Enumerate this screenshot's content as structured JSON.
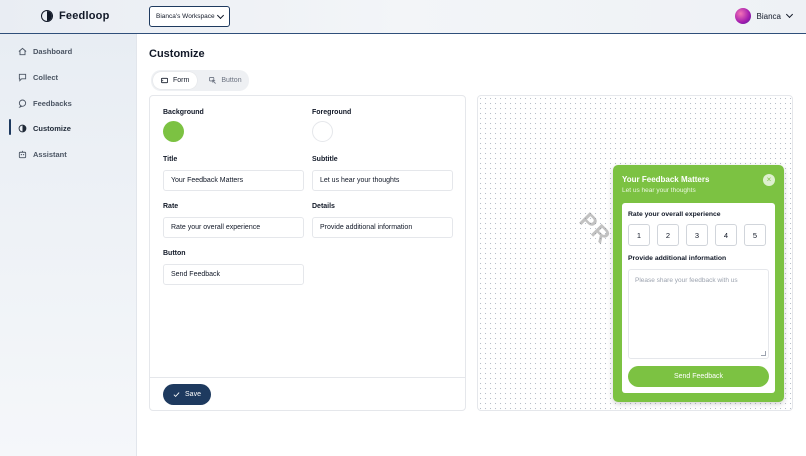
{
  "app": {
    "name": "Feedloop"
  },
  "header": {
    "workspace_label": "Bianca's Workspace",
    "user_name": "Bianca"
  },
  "sidebar": {
    "items": [
      {
        "label": "Dashboard",
        "icon": "home-icon"
      },
      {
        "label": "Collect",
        "icon": "chat-collect-icon"
      },
      {
        "label": "Feedbacks",
        "icon": "chat-bubble-icon"
      },
      {
        "label": "Customize",
        "icon": "half-circle-icon",
        "active": true
      },
      {
        "label": "Assistant",
        "icon": "robot-icon"
      }
    ]
  },
  "page": {
    "title": "Customize"
  },
  "tabs": [
    {
      "label": "Form",
      "icon": "form-icon",
      "active": true
    },
    {
      "label": "Button",
      "icon": "pointer-icon",
      "active": false
    }
  ],
  "form": {
    "background_label": "Background",
    "foreground_label": "Foreground",
    "background_color": "#7cc242",
    "foreground_color": "#ffffff",
    "title_label": "Title",
    "title_value": "Your Feedback Matters",
    "subtitle_label": "Subtitle",
    "subtitle_value": "Let us hear your thoughts",
    "rate_label": "Rate",
    "rate_value": "Rate your overall experience",
    "details_label": "Details",
    "details_value": "Provide additional information",
    "button_label": "Button",
    "button_value": "Send Feedback",
    "save_label": "Save"
  },
  "preview": {
    "watermark": "PR",
    "widget": {
      "title": "Your Feedback Matters",
      "subtitle": "Let us hear your thoughts",
      "rate_label": "Rate your overall experience",
      "ratings": [
        "1",
        "2",
        "3",
        "4",
        "5"
      ],
      "details_label": "Provide additional information",
      "textarea_placeholder": "Please share your feedback with us",
      "submit_label": "Send Feedback",
      "close_glyph": "×"
    }
  },
  "colors": {
    "accent": "#1e3a5f",
    "widget_green": "#7cc242"
  }
}
